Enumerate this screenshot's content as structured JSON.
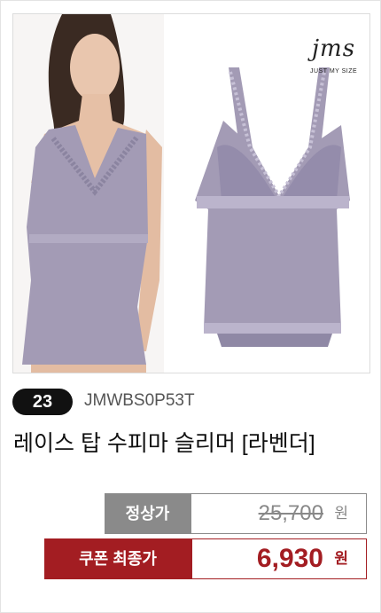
{
  "product": {
    "rank": "23",
    "sku": "JMWBS0P53T",
    "title": "레이스 탑 수피마 슬리머 [라벤더]",
    "brand_logo_text": "jms",
    "brand_tagline": "JUST MY SIZE"
  },
  "pricing": {
    "regular_label": "정상가",
    "regular_price": "25,700",
    "regular_unit": "원",
    "coupon_label": "쿠폰 최종가",
    "coupon_price": "6,930",
    "coupon_unit": "원"
  },
  "colors": {
    "accent": "#a31d22",
    "lavender": "#a39bb5"
  },
  "icons": {
    "model_photo": "model-photo-image",
    "product_photo": "product-photo-image"
  }
}
